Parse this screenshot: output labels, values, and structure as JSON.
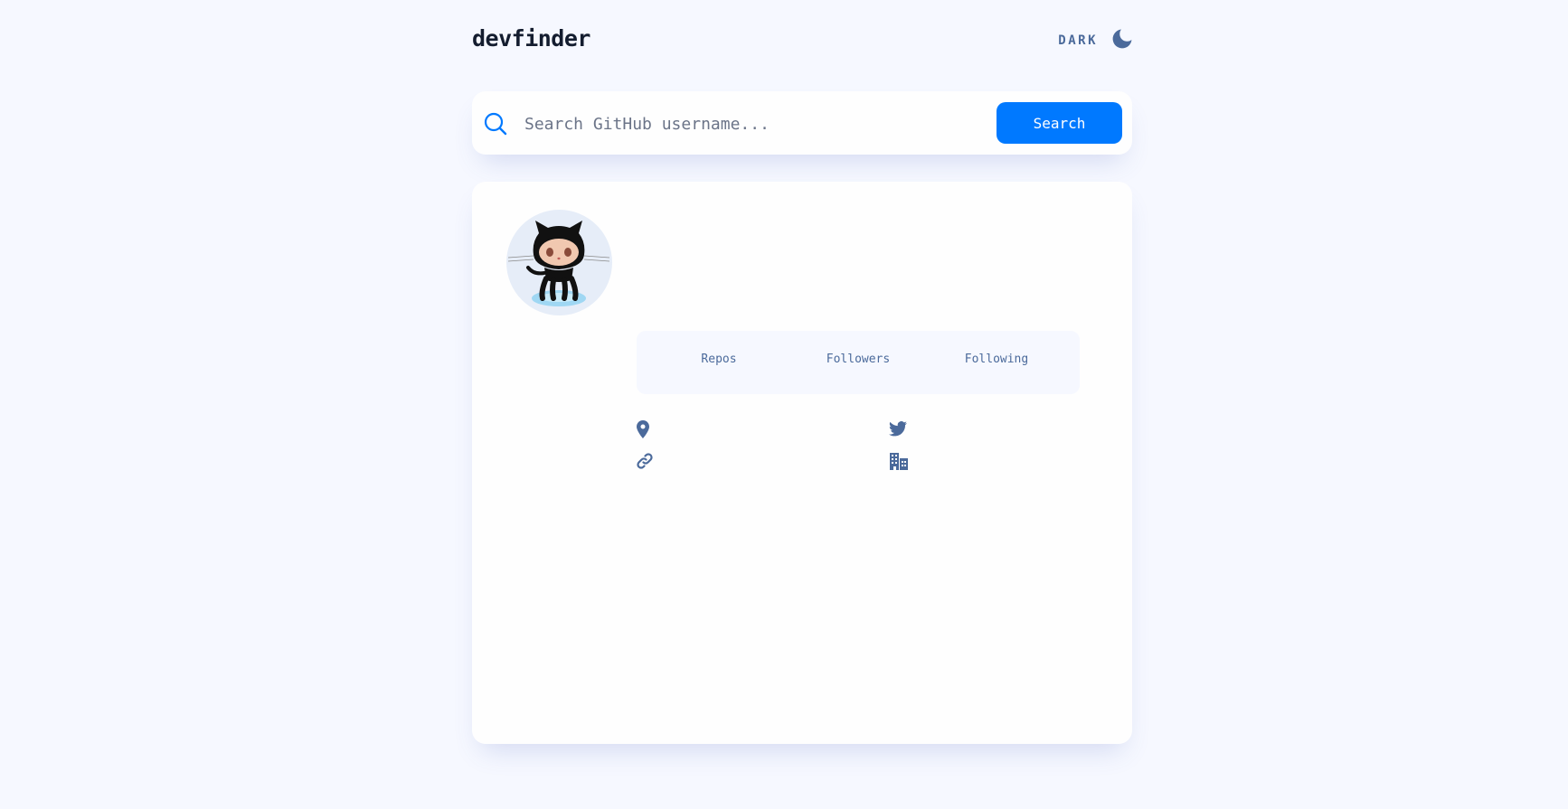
{
  "header": {
    "logo": "devfinder",
    "theme_toggle_label": "DARK",
    "theme_icon": "moon-icon"
  },
  "search": {
    "placeholder": "Search GitHub username...",
    "value": "",
    "button_label": "Search",
    "icon": "search-icon"
  },
  "profile": {
    "avatar": "github-octocat-avatar",
    "stats": {
      "repos_label": "Repos",
      "followers_label": "Followers",
      "following_label": "Following"
    },
    "links": {
      "location_icon": "location-pin-icon",
      "twitter_icon": "twitter-icon",
      "website_icon": "link-icon",
      "company_icon": "building-icon"
    }
  },
  "colors": {
    "background": "#f6f8ff",
    "card": "#fefefe",
    "accent": "#0079ff",
    "muted": "#4b6a9b",
    "heading": "#141d2f"
  }
}
